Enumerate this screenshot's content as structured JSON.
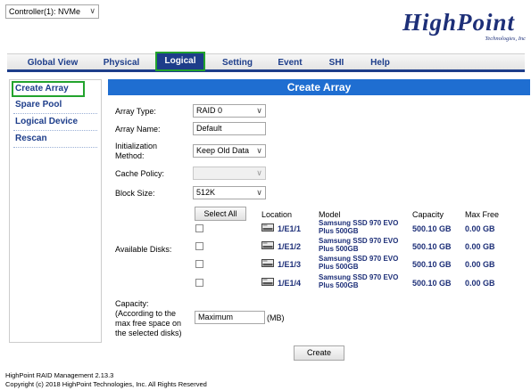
{
  "controller_select": "Controller(1): NVMe",
  "logo": {
    "name": "HighPoint",
    "subtitle": "Technologies, Inc"
  },
  "nav": {
    "tabs": [
      {
        "label": "Global View"
      },
      {
        "label": "Physical"
      },
      {
        "label": "Logical",
        "active": true
      },
      {
        "label": "Setting"
      },
      {
        "label": "Event"
      },
      {
        "label": "SHI"
      },
      {
        "label": "Help"
      }
    ]
  },
  "sidebar": {
    "items": [
      {
        "label": "Create Array",
        "active": true
      },
      {
        "label": "Spare Pool"
      },
      {
        "label": "Logical Device"
      },
      {
        "label": "Rescan"
      }
    ]
  },
  "form": {
    "title": "Create Array",
    "array_type_label": "Array Type:",
    "array_type_value": "RAID 0",
    "array_name_label": "Array Name:",
    "array_name_value": "Default",
    "init_label_1": "Initialization",
    "init_label_2": "Method:",
    "init_value": "Keep Old Data",
    "cache_label": "Cache Policy:",
    "cache_value": "",
    "block_label": "Block Size:",
    "block_value": "512K",
    "available_label": "Available Disks:",
    "select_all": "Select All",
    "columns": {
      "location": "Location",
      "model": "Model",
      "capacity": "Capacity",
      "max_free": "Max Free"
    },
    "disks": [
      {
        "location": "1/E1/1",
        "model_1": "Samsung SSD 970 EVO",
        "model_2": "Plus 500GB",
        "capacity": "500.10 GB",
        "max_free": "0.00 GB",
        "checked": false
      },
      {
        "location": "1/E1/2",
        "model_1": "Samsung SSD 970 EVO",
        "model_2": "Plus 500GB",
        "capacity": "500.10 GB",
        "max_free": "0.00 GB",
        "checked": false
      },
      {
        "location": "1/E1/3",
        "model_1": "Samsung SSD 970 EVO",
        "model_2": "Plus 500GB",
        "capacity": "500.10 GB",
        "max_free": "0.00 GB",
        "checked": false
      },
      {
        "location": "1/E1/4",
        "model_1": "Samsung SSD 970 EVO",
        "model_2": "Plus 500GB",
        "capacity": "500.10 GB",
        "max_free": "0.00 GB",
        "checked": false
      }
    ],
    "capacity_label_1": "Capacity:",
    "capacity_label_2": "(According to the",
    "capacity_label_3": "max free space on",
    "capacity_label_4": "the selected disks)",
    "capacity_value": "Maximum",
    "capacity_unit": "(MB)",
    "create_button": "Create"
  },
  "footer": {
    "line1": "HighPoint RAID Management 2.13.3",
    "line2": "Copyright (c) 2018 HighPoint Technologies, Inc. All Rights Reserved"
  }
}
